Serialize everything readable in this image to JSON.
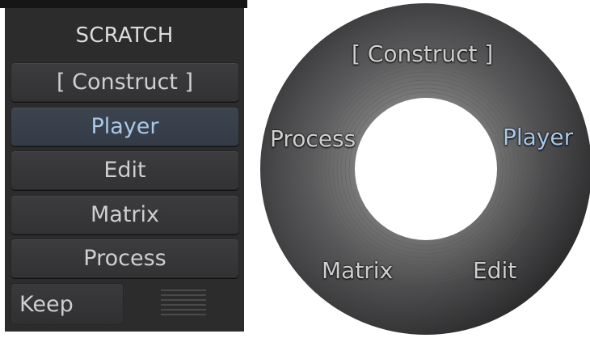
{
  "panel": {
    "title": "SCRATCH",
    "items": [
      {
        "label": "[ Construct ]",
        "active": false
      },
      {
        "label": "Player",
        "active": true
      },
      {
        "label": "Edit",
        "active": false
      },
      {
        "label": "Matrix",
        "active": false
      },
      {
        "label": "Process",
        "active": false
      }
    ],
    "keep_label": "Keep"
  },
  "radial": {
    "top": "[ Construct ]",
    "right": "Player",
    "left": "Process",
    "bottom_left": "Matrix",
    "bottom_right": "Edit"
  },
  "colors": {
    "panel_bg": "#2c2c2d",
    "button_bg": "#38383a",
    "active_bg": "#38404b",
    "active_text": "#a9c8e8",
    "text": "#cfcfcf"
  }
}
